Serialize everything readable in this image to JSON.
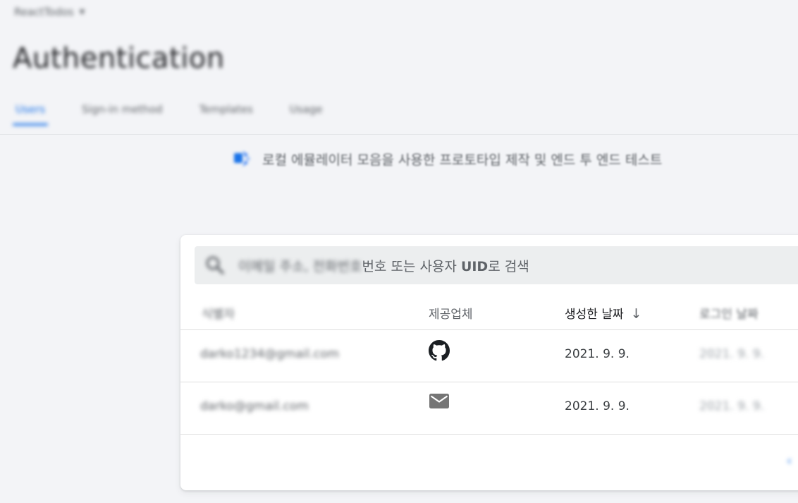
{
  "project": {
    "name": "ReactTodos",
    "chevron_icon": "chevron-down-icon"
  },
  "page": {
    "title": "Authentication"
  },
  "tabs": [
    {
      "label": "Users",
      "active": true
    },
    {
      "label": "Sign-in method",
      "active": false
    },
    {
      "label": "Templates",
      "active": false
    },
    {
      "label": "Usage",
      "active": false
    }
  ],
  "banner": {
    "icon": "emulator-icon",
    "text": "로컬 에뮬레이터 모음을 사용한 프로토타입 제작 및 엔드 투 엔드 테스트"
  },
  "search": {
    "icon": "search-icon",
    "placeholder_blurred": "이메일 주소, 전화번호",
    "placeholder_pre": "번호 또는 사용자 ",
    "placeholder_bold": "UID",
    "placeholder_post": "로 검색"
  },
  "table": {
    "columns": {
      "identifier": "식별자",
      "provider": "제공업체",
      "created": "생성한 날짜",
      "signed_in": "로그인 날짜"
    },
    "sort_icon": "arrow-down-icon",
    "rows": [
      {
        "identifier": "darko1234@gmail.com",
        "provider_icon": "github-icon",
        "created": "2021. 9. 9.",
        "signed_in": "2021. 9. 9."
      },
      {
        "identifier": "darko@gmail.com",
        "provider_icon": "email-icon",
        "created": "2021. 9. 9.",
        "signed_in": "2021. 9. 9."
      }
    ]
  },
  "colors": {
    "accent": "#1a73e8",
    "background": "#f3f4f7",
    "card": "#ffffff"
  }
}
